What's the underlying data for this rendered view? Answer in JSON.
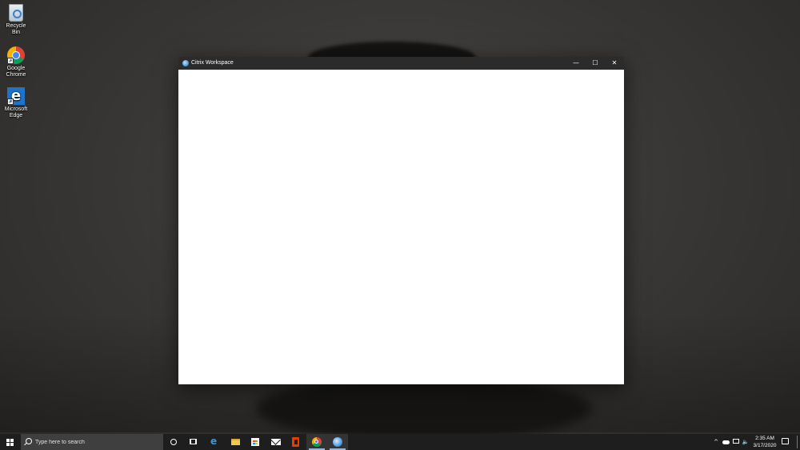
{
  "desktop": {
    "icons": [
      {
        "label": "Recycle Bin",
        "icon": "recycle-bin-icon"
      },
      {
        "label": "Google Chrome",
        "icon": "chrome-icon"
      },
      {
        "label": "Microsoft Edge",
        "icon": "edge-icon"
      }
    ]
  },
  "window": {
    "title": "Citrix Workspace",
    "app_icon": "citrix-icon",
    "controls": {
      "minimize": "—",
      "maximize": "☐",
      "close": "✕"
    }
  },
  "taskbar": {
    "search_placeholder": "Type here to search",
    "pinned": [
      {
        "name": "cortana",
        "icon": "cortana-icon"
      },
      {
        "name": "task-view",
        "icon": "task-view-icon"
      },
      {
        "name": "edge",
        "icon": "edge-icon"
      },
      {
        "name": "file-explorer",
        "icon": "folder-icon"
      },
      {
        "name": "store",
        "icon": "store-icon"
      },
      {
        "name": "mail",
        "icon": "mail-icon"
      },
      {
        "name": "office",
        "icon": "office-icon"
      },
      {
        "name": "chrome",
        "icon": "chrome-icon"
      },
      {
        "name": "citrix-workspace",
        "icon": "citrix-icon"
      }
    ],
    "tray": {
      "chevron": "^",
      "volume": "🔈",
      "time": "2:35 AM",
      "date": "3/17/2020"
    }
  },
  "colors": {
    "taskbar_bg": "#1e1e1e",
    "titlebar_bg": "#2b2b2b",
    "window_bg": "#ffffff",
    "active_indicator": "#9ab4d6"
  }
}
